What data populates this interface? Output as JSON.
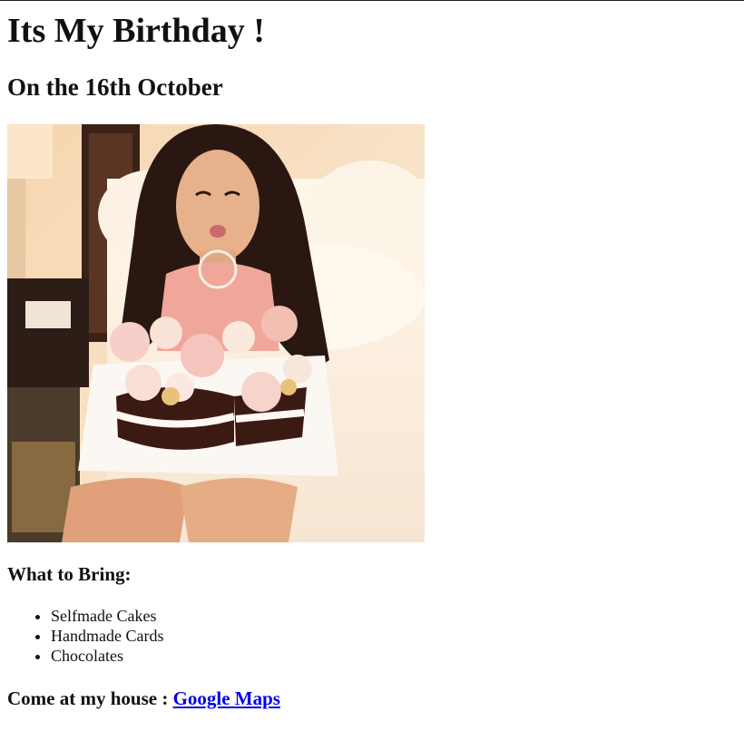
{
  "page": {
    "title": "Its My Birthday !",
    "date": "On the 16th October",
    "photo_alt": "Birthday photo",
    "bring_heading": "What to Bring:",
    "bring_items": [
      "Selfmade Cakes",
      "Handmade Cards",
      "Chocolates"
    ],
    "location_label": "Come at my house : ",
    "location_link": "Google Maps"
  },
  "colors": {
    "link": "#0000ee",
    "text": "#111111"
  }
}
